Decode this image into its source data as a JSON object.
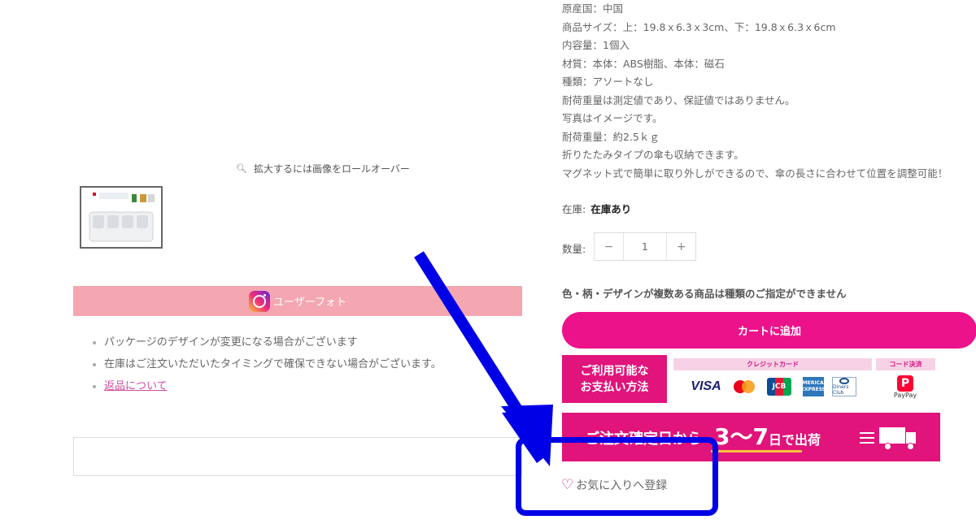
{
  "gallery": {
    "zoom_hint": "拡大するには画像をロールオーバー",
    "thumbnail_alt": "product-thumbnail"
  },
  "user_photo": {
    "label": "ユーザーフォト"
  },
  "notes": {
    "items": [
      "パッケージのデザインが変更になる場合がございます",
      "在庫はご注文いただいたタイミングで確保できない場合がございます。"
    ],
    "returns_link": "返品について"
  },
  "specs": [
    "原産国：中国",
    "商品サイズ：上：19.8ｘ6.3ｘ3cm、下：19.8ｘ6.3ｘ6cm",
    "内容量：1個入",
    "材質：本体：ABS樹脂、本体：磁石",
    "種類：アソートなし",
    "耐荷重量は測定値であり、保証値ではありません。",
    "写真はイメージです。",
    "耐荷重量：約2.5ｋｇ",
    "折りたたみタイプの傘も収納できます。",
    "マグネット式で簡単に取り外しができるので、傘の長さに合わせて位置を調整可能！"
  ],
  "stock": {
    "label": "在庫:",
    "value": "在庫あり"
  },
  "quantity": {
    "label": "数量:",
    "minus": "−",
    "value": "1",
    "plus": "+"
  },
  "variant_notice": "色・柄・デザインが複数ある商品は種類のご指定ができません",
  "cart_button": "カートに追加",
  "payment": {
    "box_line1": "ご利用可能な",
    "box_line2": "お支払い方法",
    "credit_heading": "クレジットカード",
    "code_heading": "コード決済",
    "visa": "VISA",
    "jcb": "JCB",
    "amex": "AMERICAN EXPRESS",
    "diners": "Diners Club",
    "paypay": "PayPay"
  },
  "shipping": {
    "prefix": "ご注文確定日から",
    "days": "3～7",
    "unit": "日",
    "suffix": "で出荷"
  },
  "favorite": {
    "label": "お気に入りへ登録"
  },
  "colors": {
    "accent": "#ec128a",
    "pay_pink": "#e0147a",
    "annotation_blue": "#0000e6",
    "user_photo_bg": "#f4a7b1"
  }
}
